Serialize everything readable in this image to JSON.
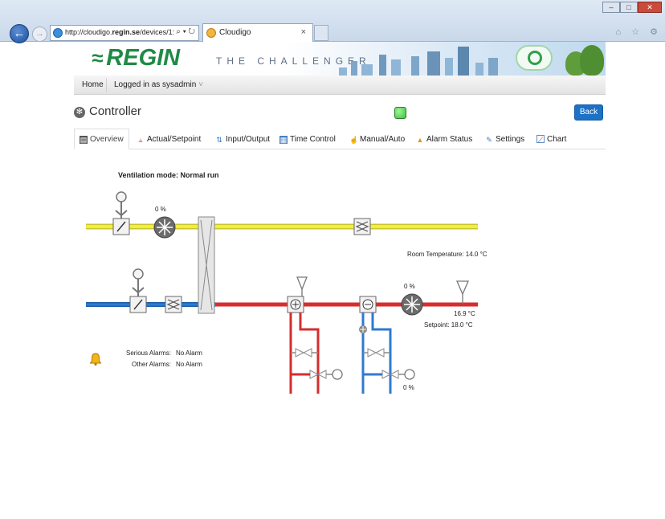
{
  "browser": {
    "url_prefix": "http://cloudigo.",
    "url_host": "regin.se",
    "url_suffix": "/devices/1:",
    "url_tools": "⌕ ▾ ↻",
    "tab_title": "Cloudigo",
    "tab_close": "×",
    "back_glyph": "←",
    "fwd_glyph": "→",
    "window_buttons": [
      "–",
      "□",
      "✕"
    ],
    "right_icons": "⌂ ☆ ⚙"
  },
  "banner": {
    "logo": "REGIN",
    "logo_mark": "≈",
    "slogan": "THE CHALLENGER"
  },
  "menu": {
    "home": "Home",
    "user": "Logged in as sysadmin",
    "caret": "˅"
  },
  "page": {
    "title": "Controller",
    "title_icon": "fan-gear-icon",
    "back_label": "Back",
    "status_color": "#3cc43a"
  },
  "tabs": [
    {
      "label": "Overview",
      "icon": "overview-icon"
    },
    {
      "label": "Actual/Setpoint",
      "icon": "sliders-icon"
    },
    {
      "label": "Input/Output",
      "icon": "io-arrows-icon"
    },
    {
      "label": "Time Control",
      "icon": "calendar-icon"
    },
    {
      "label": "Manual/Auto",
      "icon": "hand-icon"
    },
    {
      "label": "Alarm Status",
      "icon": "warning-icon"
    },
    {
      "label": "Settings",
      "icon": "settings-icon"
    },
    {
      "label": "Chart",
      "icon": "chart-icon"
    }
  ],
  "overview": {
    "ventilation_mode": "Ventilation mode:  Normal run",
    "exhaust_fan_pct": "0 %",
    "supply_fan_pct": "0 %",
    "room_temperature": "Room Temperature:  14.0 °C",
    "supply_temp": "16.9 °C",
    "setpoint": "Setpoint:  18.0 °C",
    "cooling_valve_pct": "0 %",
    "serious_alarms_label": "Serious Alarms:",
    "serious_alarms_value": "No Alarm",
    "other_alarms_label": "Other Alarms:",
    "other_alarms_value": "No Alarm",
    "colors": {
      "exhaust_duct": "#f1ee3a",
      "outdoor_duct": "#2f7ad1",
      "supply_duct": "#d72d2d",
      "heating_pipe": "#d72d2d",
      "cooling_pipe": "#2f7ad1"
    }
  }
}
